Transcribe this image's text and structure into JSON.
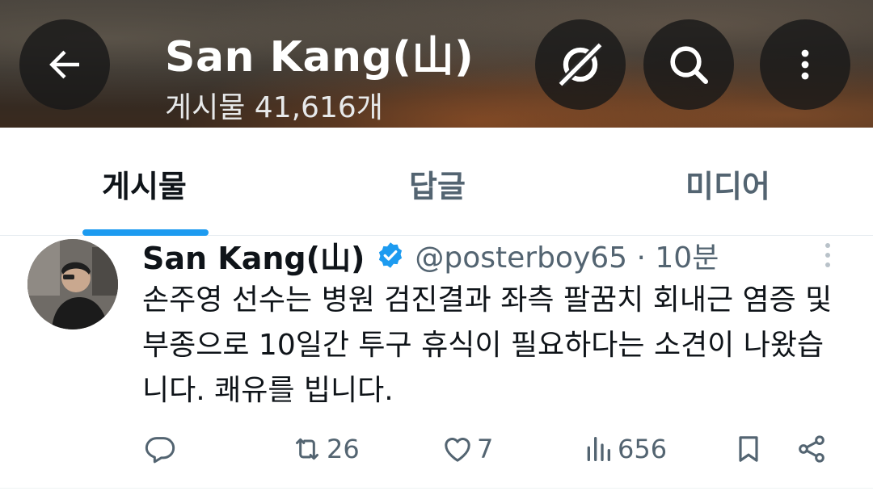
{
  "header": {
    "title": "San Kang(山)",
    "post_count": "게시물 41,616개"
  },
  "tabs": [
    {
      "label": "게시물",
      "active": true
    },
    {
      "label": "답글",
      "active": false
    },
    {
      "label": "미디어",
      "active": false
    }
  ],
  "tweet": {
    "name": "San Kang(山)",
    "handle_time": "@posterboy65 · 10분",
    "text": "손주영 선수는 병원 검진결과 좌측 팔꿈치 회내근 염증 및 부종으로 10일간 투구 휴식이 필요하다는 소견이 나왔습니다. 쾌유를 빕니다.",
    "retweets": "26",
    "likes": "7",
    "views": "656"
  },
  "colors": {
    "accent": "#1d9bf0",
    "muted": "#536471",
    "text": "#0f1419"
  },
  "icons": [
    "back-arrow-icon",
    "grok-icon",
    "search-icon",
    "more-vertical-icon",
    "verified-badge-icon",
    "reply-icon",
    "retweet-icon",
    "like-icon",
    "views-icon",
    "bookmark-icon",
    "share-icon"
  ]
}
